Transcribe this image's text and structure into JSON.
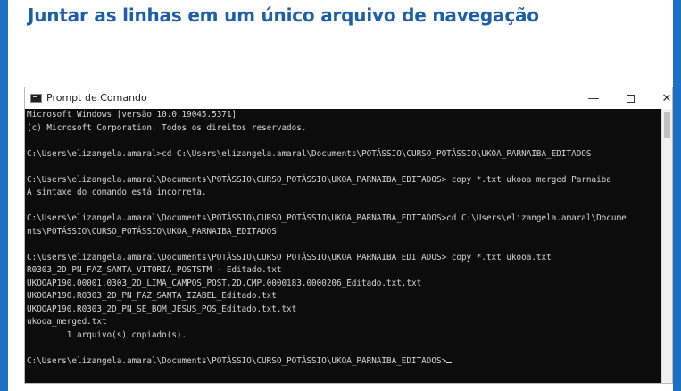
{
  "slide": {
    "title": "Juntar as linhas em um único arquivo de navegação"
  },
  "window": {
    "title": "Prompt de Comando",
    "minimize_glyph": "—",
    "close_glyph": "✕"
  },
  "console": {
    "lines": [
      "Microsoft Windows [versão 10.0.19045.5371]",
      "(c) Microsoft Corporation. Todos os direitos reservados.",
      "",
      "C:\\Users\\elizangela.amaral>cd C:\\Users\\elizangela.amaral\\Documents\\POTÁSSIO\\CURSO_POTÁSSIO\\UKOA_PARNAIBA_EDITADOS",
      "",
      "C:\\Users\\elizangela.amaral\\Documents\\POTÁSSIO\\CURSO_POTÁSSIO\\UKOA_PARNAIBA_EDITADOS> copy *.txt ukooa merged Parnaiba",
      "A sintaxe do comando está incorreta.",
      "",
      "C:\\Users\\elizangela.amaral\\Documents\\POTÁSSIO\\CURSO_POTÁSSIO\\UKOA_PARNAIBA_EDITADOS>cd C:\\Users\\elizangela.amaral\\Docume",
      "nts\\POTÁSSIO\\CURSO_POTÁSSIO\\UKOA_PARNAIBA_EDITADOS",
      "",
      "C:\\Users\\elizangela.amaral\\Documents\\POTÁSSIO\\CURSO_POTÁSSIO\\UKOA_PARNAIBA_EDITADOS> copy *.txt ukooa.txt",
      "R0303_2D_PN_FAZ_SANTA_VITORIA_POSTSTM - Editado.txt",
      "UKOOAP190.00001.0303_2D_LIMA_CAMPOS_POST.2D.CMP.0000183.0000206_Editado.txt.txt",
      "UKOOAP190.R0303_2D_PN_FAZ_SANTA_IZABEL_Editado.txt",
      "UKOOAP190.R0303_2D_PN_SE_BOM_JESUS_POS_Editado.txt.txt",
      "ukooa_merged.txt",
      "        1 arquivo(s) copiado(s).",
      "",
      "C:\\Users\\elizangela.amaral\\Documents\\POTÁSSIO\\CURSO_POTÁSSIO\\UKOA_PARNAIBA_EDITADOS>"
    ]
  }
}
